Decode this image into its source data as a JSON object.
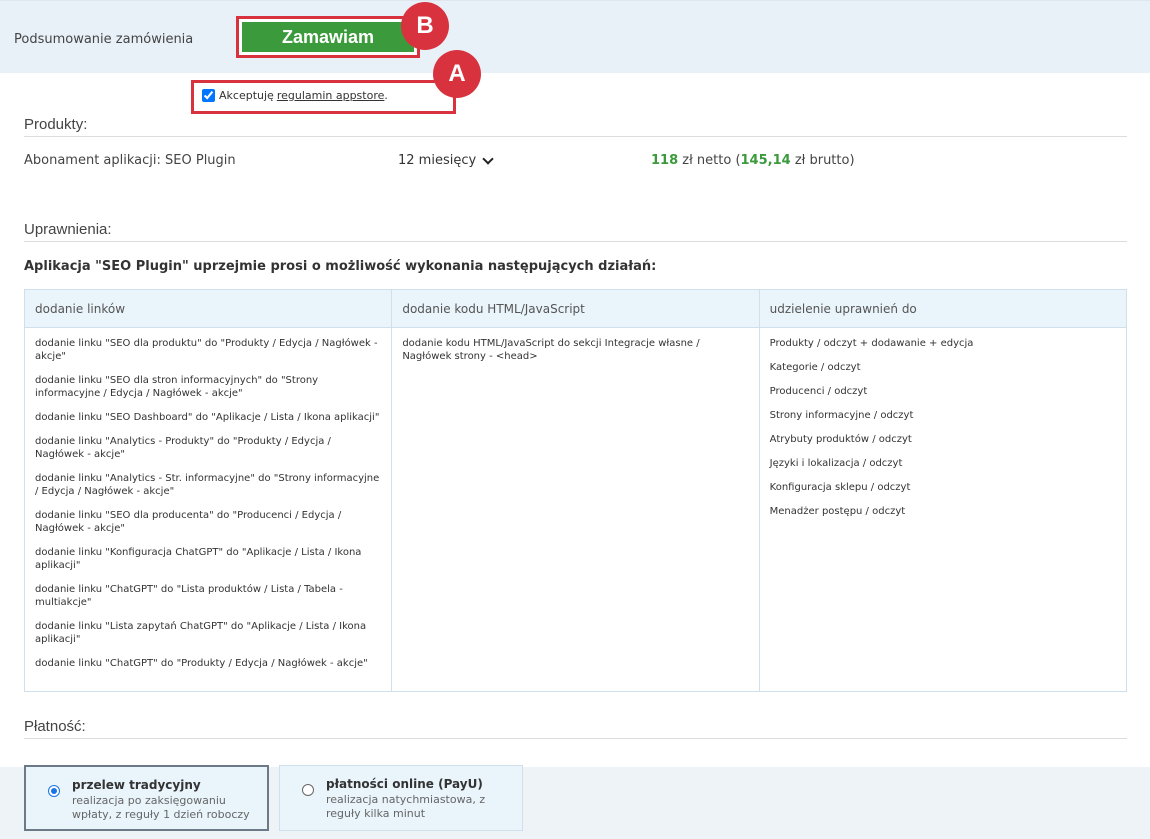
{
  "header": {
    "title": "Podsumowanie zamówienia",
    "order_button": "Zamawiam",
    "badge_a": "A",
    "badge_b": "B"
  },
  "terms": {
    "checked": true,
    "prefix": "Akceptuję",
    "link": "regulamin appstore",
    "suffix": "."
  },
  "products": {
    "title": "Produkty:",
    "name": "Abonament aplikacji: SEO Plugin",
    "period": "12 miesięcy",
    "net_value": "118",
    "net_label": " zł netto (",
    "gross_value": "145,14",
    "gross_label": " zł brutto)"
  },
  "permissions": {
    "title": "Uprawnienia:",
    "heading": "Aplikacja \"SEO Plugin\" uprzejmie prosi o możliwość wykonania następujących działań:",
    "columns": [
      {
        "header": "dodanie linków",
        "items": [
          "dodanie linku \"SEO dla produktu\" do \"Produkty / Edycja / Nagłówek - akcje\"",
          "dodanie linku \"SEO dla stron informacyjnych\" do \"Strony informacyjne / Edycja / Nagłówek - akcje\"",
          "dodanie linku \"SEO Dashboard\" do \"Aplikacje / Lista / Ikona aplikacji\"",
          "dodanie linku \"Analytics - Produkty\" do \"Produkty / Edycja / Nagłówek - akcje\"",
          "dodanie linku \"Analytics - Str. informacyjne\" do \"Strony informacyjne / Edycja / Nagłówek - akcje\"",
          "dodanie linku \"SEO dla producenta\" do \"Producenci / Edycja / Nagłówek - akcje\"",
          "dodanie linku \"Konfiguracja ChatGPT\" do \"Aplikacje / Lista / Ikona aplikacji\"",
          "dodanie linku \"ChatGPT\" do \"Lista produktów / Lista / Tabela - multiakcje\"",
          "dodanie linku \"Lista zapytań ChatGPT\" do \"Aplikacje / Lista / Ikona aplikacji\"",
          "dodanie linku \"ChatGPT\" do \"Produkty / Edycja / Nagłówek - akcje\""
        ]
      },
      {
        "header": "dodanie kodu HTML/JavaScript",
        "items": [
          "dodanie kodu HTML/JavaScript do sekcji Integracje własne / Nagłówek strony - <head>"
        ]
      },
      {
        "header": "udzielenie uprawnień do",
        "items": [
          "Produkty / odczyt + dodawanie + edycja",
          "Kategorie / odczyt",
          "Producenci / odczyt",
          "Strony informacyjne / odczyt",
          "Atrybuty produktów / odczyt",
          "Języki i lokalizacja / odczyt",
          "Konfiguracja sklepu / odczyt",
          "Menadżer postępu / odczyt"
        ]
      }
    ]
  },
  "payment": {
    "title": "Płatność:",
    "options": [
      {
        "title": "przelew tradycyjny",
        "desc": "realizacja po zaksięgowaniu wpłaty, z reguły 1 dzień roboczy",
        "selected": true
      },
      {
        "title": "płatności online (PayU)",
        "desc": "realizacja natychmiastowa, z reguły kilka minut",
        "selected": false
      }
    ]
  },
  "colors": {
    "accent_green": "#3a9a3c",
    "highlight_red": "#d9323f",
    "header_bg": "#e9f1f8"
  }
}
